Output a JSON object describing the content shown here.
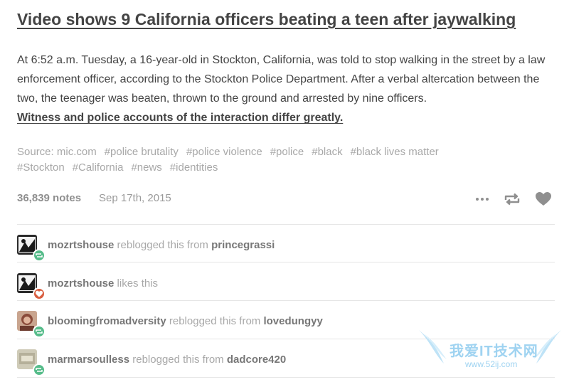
{
  "post": {
    "title": "Video shows 9 California officers beating a teen after jaywalking",
    "body_text": "At 6:52 a.m. Tuesday, a 16-year-old in Stockton, California, was told to stop walking in the street by a law enforcement officer, according to the Stockton Police Department. After a verbal altercation between the two, the teenager was beaten, thrown to the ground and arrested by nine officers.",
    "body_link": "Witness and police accounts of the interaction differ greatly.",
    "source": "Source: mic.com",
    "tags": [
      "#police brutality",
      "#police violence",
      "#police",
      "#black",
      "#black lives matter",
      "#Stockton",
      "#California",
      "#news",
      "#identities"
    ],
    "notes_count": "36,839 notes",
    "date": "Sep 17th, 2015",
    "actions": {
      "more_icon": "more-dots-icon",
      "reblog_icon": "reblog-icon",
      "like_icon": "heart-icon"
    }
  },
  "notes": [
    {
      "user": "mozrtshouse",
      "action": "reblogged this from",
      "target": "princegrassi",
      "badge": "reblog",
      "avatar": "avatar-a"
    },
    {
      "user": "mozrtshouse",
      "action": "likes this",
      "target": "",
      "badge": "like",
      "avatar": "avatar-a"
    },
    {
      "user": "bloomingfromadversity",
      "action": "reblogged this from",
      "target": "lovedungyy",
      "badge": "reblog",
      "avatar": "avatar-b"
    },
    {
      "user": "marmarsoulless",
      "action": "reblogged this from",
      "target": "dadcore420",
      "badge": "reblog",
      "avatar": "avatar-c"
    }
  ],
  "colors": {
    "text": "#444444",
    "muted": "#a8a8a8",
    "reblog_green": "#56bc8a",
    "like_red": "#d95e40",
    "watermark": "#9fd3f1"
  },
  "watermark": {
    "text": "我爱IT技术网",
    "url": "www.52ij.com"
  }
}
